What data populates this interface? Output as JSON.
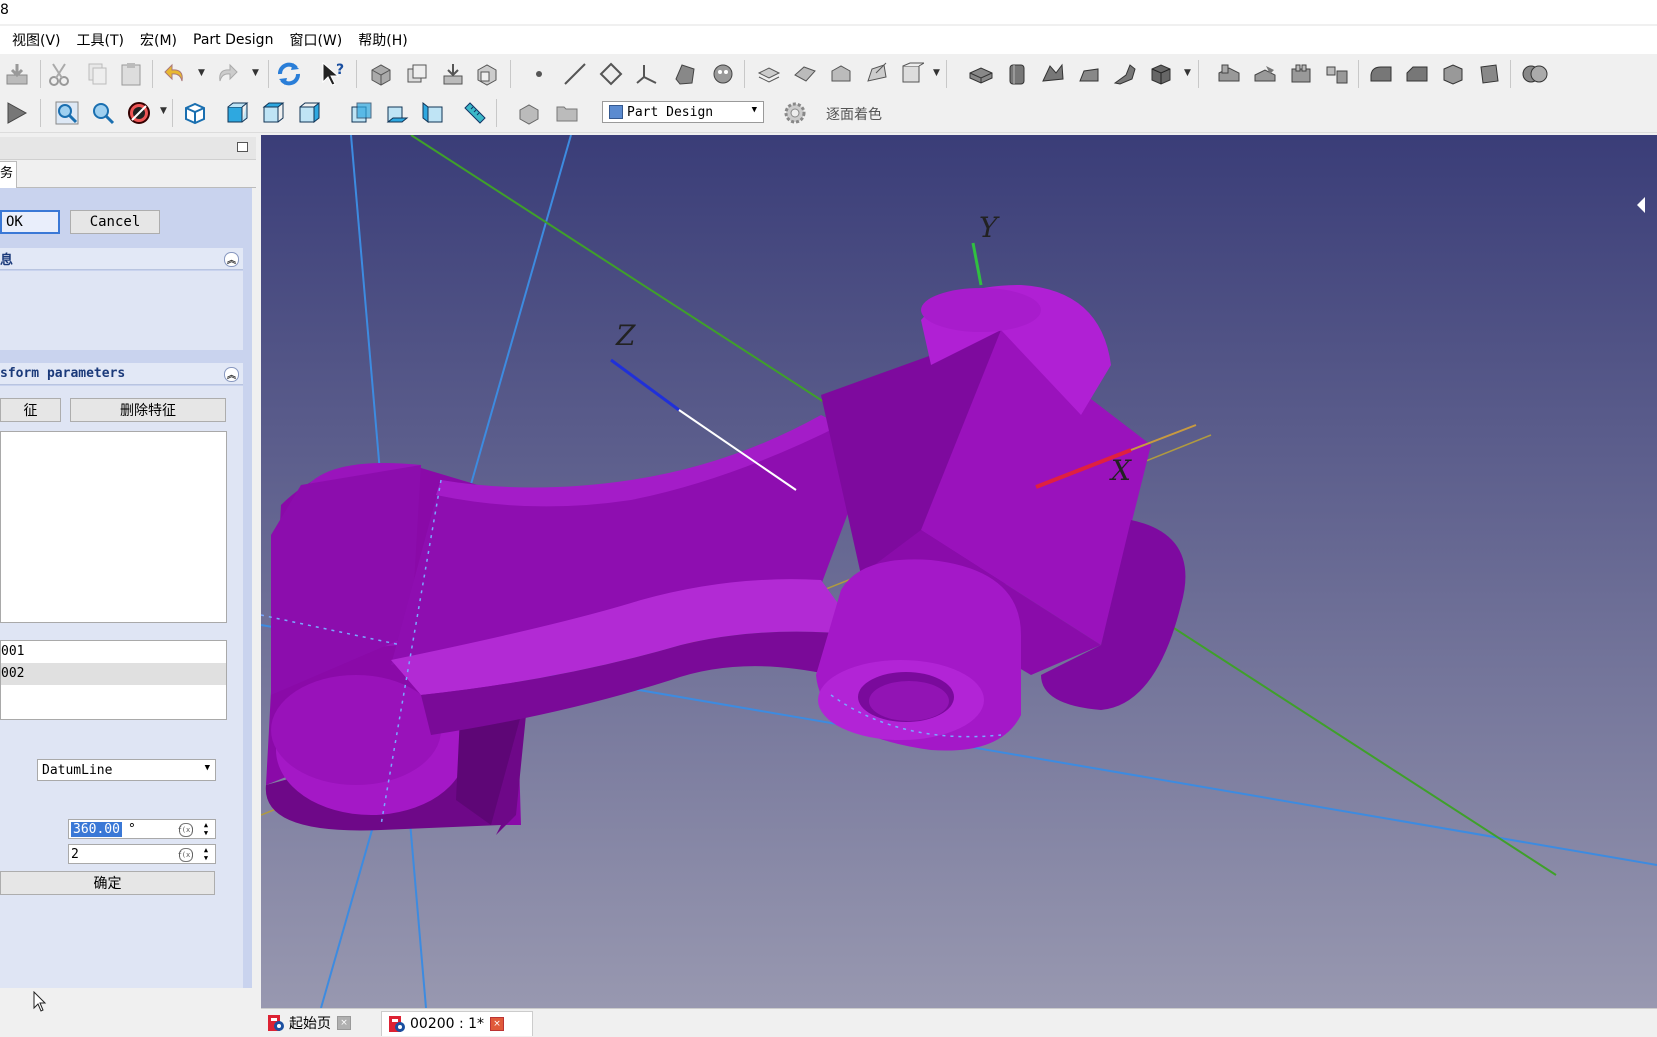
{
  "window": {
    "title_fragment": "8"
  },
  "menu": [
    "视图(V)",
    "工具(T)",
    "宏(M)",
    "Part Design",
    "窗口(W)",
    "帮助(H)"
  ],
  "toolbar2": {
    "workbench": "Part Design",
    "shading_label": "逐面着色"
  },
  "task_panel": {
    "tab_label": "务",
    "ok_label": "OK",
    "cancel_label": "Cancel",
    "message_group_title": "息",
    "transform_group_title": "sform parameters",
    "add_feature_label": "征",
    "remove_feature_label": "删除特征",
    "originals": [
      "001",
      "002"
    ],
    "axis_value": "DatumLine",
    "angle_value": "360.00",
    "angle_unit": "°",
    "occurrences_value": "2",
    "confirm_label": "确定"
  },
  "viewport": {
    "axis_labels": {
      "x": "X",
      "y": "Y",
      "z": "Z"
    },
    "part_color": "#a010c0",
    "background_top": "#3a3d78",
    "background_bottom": "#9898b0"
  },
  "doc_tabs": [
    {
      "label": "起始页",
      "active": false
    },
    {
      "label": "00200 : 1*",
      "active": true
    }
  ]
}
